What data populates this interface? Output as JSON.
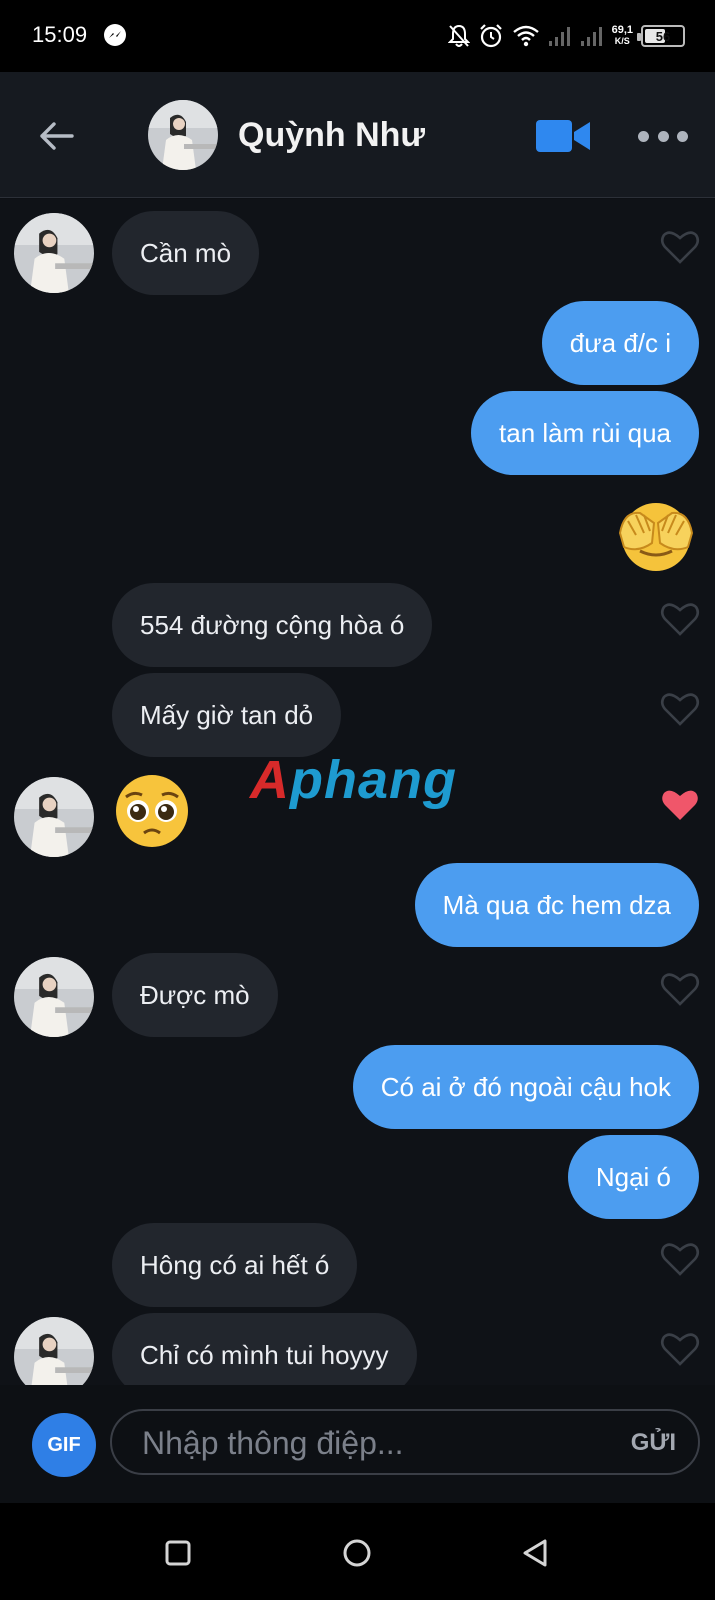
{
  "status_bar": {
    "time": "15:09",
    "net_speed_value": "69,1",
    "net_speed_unit": "K/S",
    "battery": "56",
    "battery_level": 0.56,
    "icons": [
      "messenger-icon",
      "bell-off-icon",
      "alarm-icon",
      "wifi-icon",
      "signal-icon",
      "signal-icon",
      "battery-icon"
    ]
  },
  "header": {
    "back_icon": "back-arrow-icon",
    "contact_name": "Quỳnh Như",
    "video_icon": "video-camera-icon",
    "more_icon": "more-dots-icon"
  },
  "messages": [
    {
      "side": "in",
      "text": "Cần mò",
      "liked": false
    },
    {
      "side": "out",
      "text": "đưa đ/c i"
    },
    {
      "side": "out",
      "text": "tan làm rùi qua"
    },
    {
      "side": "out",
      "emoji": "🙈",
      "emoji_name": "see-no-evil-monkey-emoji"
    },
    {
      "side": "in",
      "text": "554 đường cộng hòa ó",
      "liked": false
    },
    {
      "side": "in",
      "text": "Mấy giờ tan dỏ",
      "liked": false
    },
    {
      "side": "in",
      "emoji": "🥺",
      "emoji_name": "pleading-face-emoji",
      "liked": true
    },
    {
      "side": "out",
      "text": "Mà qua đc hem dza"
    },
    {
      "side": "in",
      "text": "Được mò",
      "liked": false
    },
    {
      "side": "out",
      "text": "Có ai ở đó ngoài cậu hok"
    },
    {
      "side": "out",
      "text": "Ngại ó"
    },
    {
      "side": "in",
      "text": "Hông có ai hết ó",
      "liked": false
    },
    {
      "side": "in",
      "text": "Chỉ có mình tui hoyyy",
      "liked": false
    }
  ],
  "watermark": {
    "part1": "A",
    "part2": "phang"
  },
  "input_bar": {
    "gif_label": "GIF",
    "placeholder": "Nhập thông điệp...",
    "send_label": "GỬI"
  },
  "nav_bar": {
    "buttons": [
      "recent-apps-icon",
      "home-icon",
      "back-triangle-icon"
    ]
  },
  "colors": {
    "outgoing_bubble": "#4c9df0",
    "incoming_bubble": "#22262d",
    "liked_heart": "#f0566a",
    "gif_button": "#2f7fe6"
  }
}
